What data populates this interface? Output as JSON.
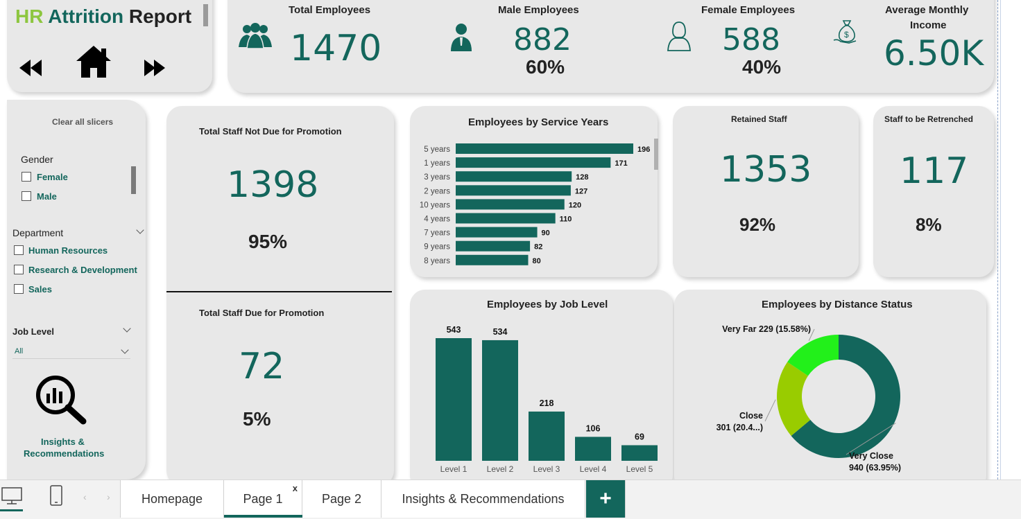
{
  "header": {
    "title_hr": "HR",
    "title_rest_1": "Attrition",
    "title_rest_2": "Report",
    "nav": {
      "prev_icon": "rewind-icon",
      "home_icon": "home-icon",
      "next_icon": "fast-forward-icon"
    }
  },
  "kpis": {
    "total": {
      "label": "Total Employees",
      "value": "1470",
      "icon": "group-icon"
    },
    "male": {
      "label": "Male Employees",
      "value": "882",
      "pct": "60%",
      "icon": "male-icon"
    },
    "female": {
      "label": "Female Employees",
      "value": "588",
      "pct": "40%",
      "icon": "female-icon"
    },
    "income": {
      "label_line1": "Average Monthly",
      "label_line2": "Income",
      "value": "6.50K",
      "icon": "money-bag-icon"
    }
  },
  "slicers": {
    "clear_label": "Clear all slicers",
    "gender": {
      "title": "Gender",
      "options": [
        "Female",
        "Male"
      ]
    },
    "department": {
      "title": "Department",
      "options": [
        "Human Resources",
        "Research & Development",
        "Sales"
      ]
    },
    "job_level": {
      "title": "Job Level",
      "selected": "All"
    },
    "insights": {
      "line1": "Insights &",
      "line2": "Recommendations",
      "icon": "analytics-search-icon"
    }
  },
  "promotion": {
    "not_due": {
      "label": "Total Staff Not Due for Promotion",
      "value": "1398",
      "pct": "95%"
    },
    "due": {
      "label": "Total Staff Due for Promotion",
      "value": "72",
      "pct": "5%"
    }
  },
  "retained": {
    "label": "Retained Staff",
    "value": "1353",
    "pct": "92%"
  },
  "retrenched": {
    "label": "Staff to be Retrenched",
    "value": "117",
    "pct": "8%"
  },
  "colors": {
    "teal": "#13665c",
    "green_bright": "#22f01a",
    "green_lime": "#99cc00",
    "hr_green": "#8dc63f"
  },
  "chart_data": [
    {
      "type": "bar",
      "orientation": "horizontal",
      "title": "Employees by Service Years",
      "categories": [
        "5 years",
        "1 years",
        "3 years",
        "2 years",
        "10 years",
        "4 years",
        "7 years",
        "9 years",
        "8 years"
      ],
      "values": [
        196,
        171,
        128,
        127,
        120,
        110,
        90,
        82,
        80
      ],
      "data_labels": [
        "196",
        "171",
        "128",
        "127",
        "120",
        "110",
        "90",
        "82",
        "80"
      ],
      "color": "#13665c"
    },
    {
      "type": "bar",
      "title": "Employees by Job Level",
      "categories": [
        "Level 1",
        "Level 2",
        "Level 3",
        "Level 4",
        "Level 5"
      ],
      "values": [
        543,
        534,
        218,
        106,
        69
      ],
      "data_labels": [
        "543",
        "534",
        "218",
        "106",
        "69"
      ],
      "color": "#13665c"
    },
    {
      "type": "pie",
      "donut": true,
      "title": "Employees by Distance Status",
      "categories": [
        "Very Close",
        "Close",
        "Very Far"
      ],
      "values": [
        940,
        301,
        229
      ],
      "label_lines": [
        [
          "Very Close",
          "940 (63.95%)"
        ],
        [
          "Close",
          "301 (20.4...)"
        ],
        [
          "Very Far 229 (15.58%)"
        ]
      ],
      "colors": [
        "#13665c",
        "#99cc00",
        "#22f01a"
      ]
    }
  ],
  "tabs": {
    "desktop_icon": "desktop-icon",
    "phone_icon": "phone-icon",
    "items": [
      "Homepage",
      "Page 1",
      "Page 2",
      "Insights & Recommendations"
    ],
    "active": "Page 1",
    "close_glyph": "x",
    "add_glyph": "+"
  }
}
